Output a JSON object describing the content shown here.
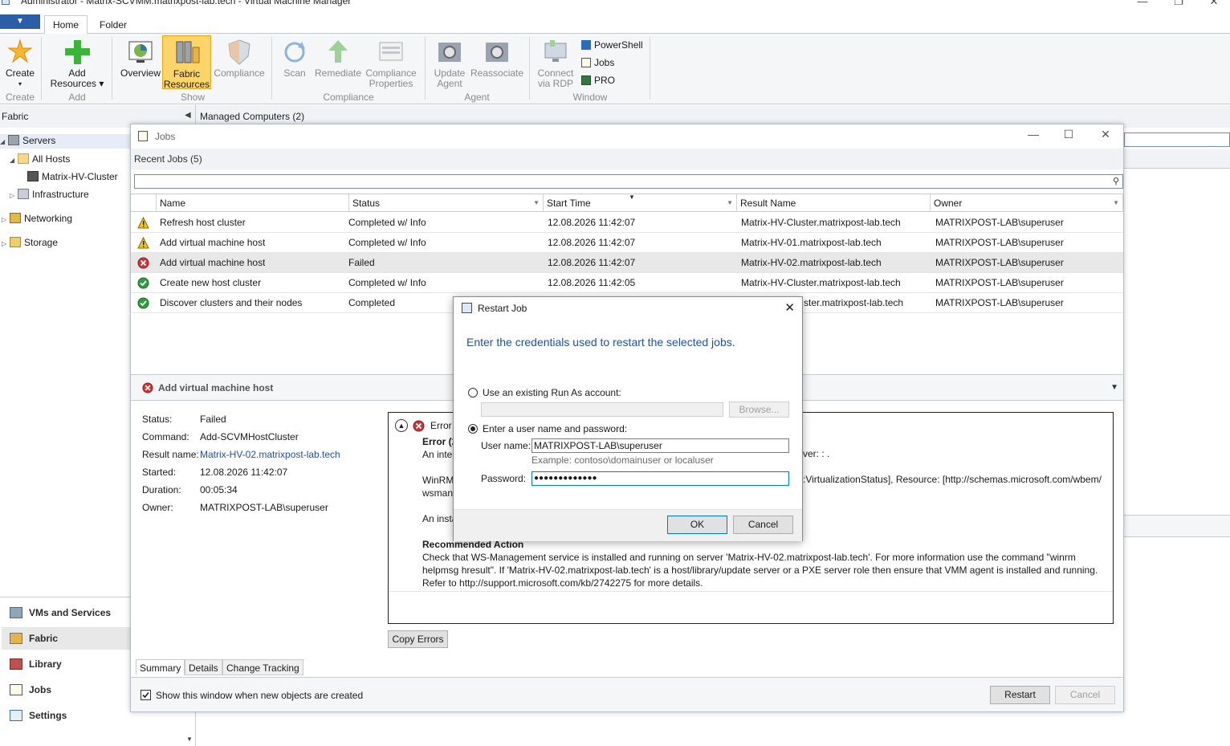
{
  "window": {
    "title": "Administrator - Matrix-SCVMM.matrixpost-lab.tech - Virtual Machine Manager",
    "minimize": "—",
    "restore": "❐",
    "close": "✕"
  },
  "ribbon": {
    "tabs": [
      {
        "label": "Home",
        "active": true
      },
      {
        "label": "Folder",
        "active": false
      }
    ],
    "buttons": {
      "create": "Create",
      "add_resources_1": "Add",
      "add_resources_2": "Resources",
      "overview": "Overview",
      "fabric_resources_1": "Fabric",
      "fabric_resources_2": "Resources",
      "compliance": "Compliance",
      "scan": "Scan",
      "remediate": "Remediate",
      "compliance_properties_1": "Compliance",
      "compliance_properties_2": "Properties",
      "update_agent_1": "Update",
      "update_agent_2": "Agent",
      "reassociate": "Reassociate",
      "connect_rdp_1": "Connect",
      "connect_rdp_2": "via RDP",
      "powershell": "PowerShell",
      "jobs": "Jobs",
      "pro": "PRO"
    },
    "groups": {
      "create": "Create",
      "add": "Add",
      "show": "Show",
      "compliance": "Compliance",
      "agent": "Agent",
      "window": "Window"
    },
    "accent_active": "#fcd56a"
  },
  "leftnav": {
    "header": "Fabric",
    "tree": {
      "servers": "Servers",
      "all_hosts": "All Hosts",
      "cluster": "Matrix-HV-Cluster",
      "infrastructure": "Infrastructure",
      "networking": "Networking",
      "storage": "Storage"
    },
    "workspaces": [
      {
        "label": "VMs and Services"
      },
      {
        "label": "Fabric"
      },
      {
        "label": "Library"
      },
      {
        "label": "Jobs"
      },
      {
        "label": "Settings"
      }
    ]
  },
  "main": {
    "header": "Managed Computers (2)"
  },
  "jobs_window": {
    "title": "Jobs",
    "recent_header": "Recent Jobs (5)",
    "columns": [
      "Name",
      "Status",
      "Start Time",
      "Result Name",
      "Owner"
    ],
    "rows": [
      {
        "icon": "warning",
        "name": "Refresh host cluster",
        "status": "Completed w/ Info",
        "start": "12.08.2026 11:42:07",
        "result": "Matrix-HV-Cluster.matrixpost-lab.tech",
        "owner": "MATRIXPOST-LAB\\superuser"
      },
      {
        "icon": "warning",
        "name": "Add virtual machine host",
        "status": "Completed w/ Info",
        "start": "12.08.2026 11:42:07",
        "result": "Matrix-HV-01.matrixpost-lab.tech",
        "owner": "MATRIXPOST-LAB\\superuser"
      },
      {
        "icon": "error",
        "name": "Add virtual machine host",
        "status": "Failed",
        "start": "12.08.2026 11:42:07",
        "result": "Matrix-HV-02.matrixpost-lab.tech",
        "owner": "MATRIXPOST-LAB\\superuser"
      },
      {
        "icon": "success",
        "name": "Create new host cluster",
        "status": "Completed w/ Info",
        "start": "12.08.2026 11:42:05",
        "result": "Matrix-HV-Cluster.matrixpost-lab.tech",
        "owner": "MATRIXPOST-LAB\\superuser"
      },
      {
        "icon": "success",
        "name": "Discover clusters and their nodes",
        "status": "Completed",
        "start": "",
        "result": "ster.matrixpost-lab.tech",
        "owner": "MATRIXPOST-LAB\\superuser"
      }
    ],
    "detail": {
      "header": "Add virtual machine host",
      "status_label": "Status:",
      "status": "Failed",
      "command_label": "Command:",
      "command": "Add-SCVMHostCluster",
      "result_label": "Result name:",
      "result": "Matrix-HV-02.matrixpost-lab.tech",
      "started_label": "Started:",
      "started": "12.08.2026 11:42:07",
      "duration_label": "Duration:",
      "duration": "00:05:34",
      "owner_label": "Owner:",
      "owner": "MATRIXPOST-LAB\\superuser",
      "error_title": "Error",
      "error_heading": "Error (2",
      "error_line1_left": "An inter",
      "error_line1_right": "ver: : .",
      "error_line2_left": "WinRM",
      "error_line2_right": ":VirtualizationStatus], Resource: [http://schemas.microsoft.com/wbem/",
      "error_line3_left": "wsman/",
      "error_line4_left": "An insta",
      "recommended_heading": "Recommended Action",
      "recommended_text_1": "Check that WS-Management service is installed and running on server 'Matrix-HV-02.matrixpost-lab.tech'. For more information use the command \"winrm",
      "recommended_text_2": "helpmsg hresult\". If 'Matrix-HV-02.matrixpost-lab.tech' is a host/library/update server or a PXE server role then ensure that VMM agent is installed and running.",
      "recommended_text_3": "Refer to http://support.microsoft.com/kb/2742275 for more details.",
      "copy_errors": "Copy Errors"
    },
    "tabs": [
      "Summary",
      "Details",
      "Change Tracking"
    ],
    "show_window_checkbox": "Show this window when new objects are created",
    "restart_button": "Restart",
    "cancel_button": "Cancel"
  },
  "restart_dialog": {
    "title": "Restart Job",
    "lead": "Enter the credentials used to restart the selected jobs.",
    "option_runas": "Use an existing Run As account:",
    "browse": "Browse...",
    "option_user": "Enter a user name and password:",
    "username_label": "User name:",
    "username_value": "MATRIXPOST-LAB\\superuser",
    "username_hint": "Example: contoso\\domainuser or localuser",
    "password_label": "Password:",
    "password_value": "●●●●●●●●●●●●●",
    "ok": "OK",
    "cancel": "Cancel"
  }
}
